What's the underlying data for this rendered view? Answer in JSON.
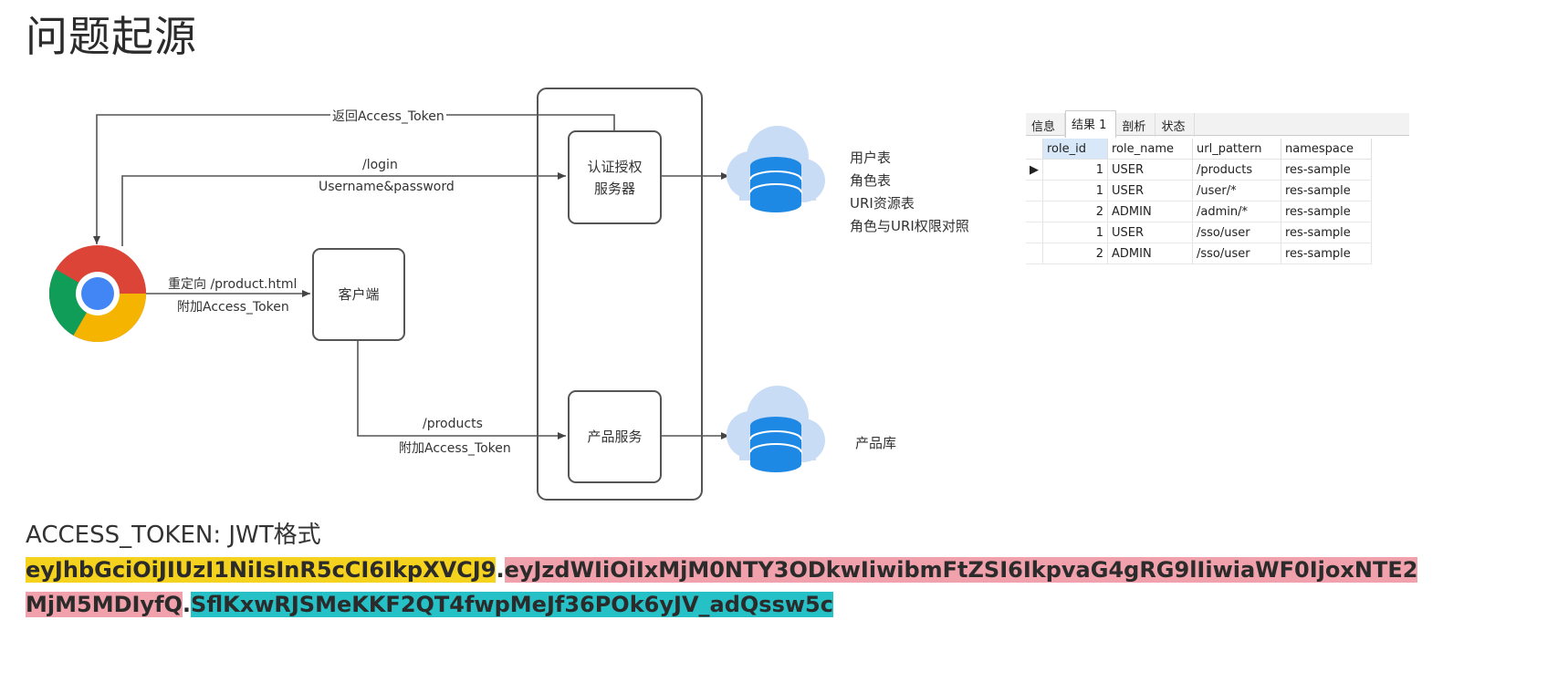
{
  "title": "问题起源",
  "diagram": {
    "auth_server_label": "认证授权\n服务器",
    "client_label": "客户端",
    "product_service_label": "产品服务",
    "return_token_label": "返回Access_Token",
    "login_path_label": "/login",
    "login_credentials_label": "Username&password",
    "redirect_label": "重定向 /product.html",
    "attach_token_label_1": "附加Access_Token",
    "products_path_label": "/products",
    "attach_token_label_2": "附加Access_Token",
    "auth_db_tables": [
      "用户表",
      "角色表",
      "URI资源表",
      "角色与URI权限对照"
    ],
    "product_db_label": "产品库",
    "icons": [
      "chrome-browser-icon",
      "database-cloud-icon"
    ]
  },
  "result_table": {
    "tabs": [
      "信息",
      "结果 1",
      "剖析",
      "状态"
    ],
    "active_tab": "结果 1",
    "columns": [
      "role_id",
      "role_name",
      "url_pattern",
      "namespace"
    ],
    "rows": [
      [
        "1",
        "USER",
        "/products",
        "res-sample"
      ],
      [
        "1",
        "USER",
        "/user/*",
        "res-sample"
      ],
      [
        "2",
        "ADMIN",
        "/admin/*",
        "res-sample"
      ],
      [
        "1",
        "USER",
        "/sso/user",
        "res-sample"
      ],
      [
        "2",
        "ADMIN",
        "/sso/user",
        "res-sample"
      ]
    ]
  },
  "token": {
    "heading": "ACCESS_TOKEN: JWT格式",
    "header_part": "eyJhbGciOiJIUzI1NiIsInR5cCI6IkpXVCJ9",
    "dot1": ".",
    "payload_part": "eyJzdWIiOiIxMjM0NTY3ODkwIiwibmFtZSI6IkpvaG4gRG9lIiwiaWF0IjoxNTE2MjM5MDIyfQ",
    "dot2": ".",
    "signature_part": "SflKxwRJSMeKKF2QT4fwpMeJf36POk6yJV_adQssw5c",
    "colors": {
      "header": "#f5d21e",
      "payload": "#f0a1ab",
      "signature": "#26c0c7"
    }
  }
}
